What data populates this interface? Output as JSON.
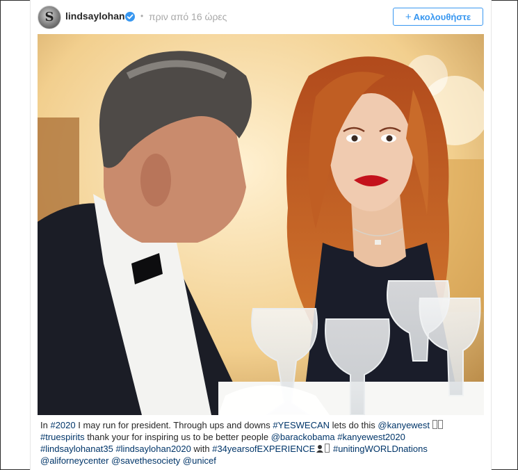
{
  "header": {
    "username": "lindsaylohan",
    "separator": "•",
    "timestamp": "πριν από 16 ώρες",
    "follow_label": "Ακολουθήστε",
    "follow_icon": "+"
  },
  "avatar": {
    "glyph": "S",
    "icon": "profile-avatar"
  },
  "icons": {
    "verified": "verified-badge-icon"
  },
  "colors": {
    "link": "#003569",
    "accent": "#3897f0",
    "muted": "#a8a8a8",
    "text": "#262626"
  },
  "caption": {
    "t0": "In ",
    "h_2020": "#2020",
    "t1": " I may run for president. Through ups and downs ",
    "h_yeswecan": "#YESWECAN",
    "t2": " lets do this ",
    "m_kanyewest": "@kanyewest",
    "h_truespirits": "#truespirits",
    "t3": " thank your for inspiring us to be better people ",
    "m_barackobama": "@barackobama",
    "h_kanyewest2020": "#kanyewest2020",
    "h_lindsaylohanat35": "#lindsaylohanat35",
    "h_lindsaylohan2020": "#lindsaylohan2020",
    "t4": " with ",
    "h_34years": "#34yearsofEXPERIENCE",
    "h_unitingworld": "#unitingWORLDnations",
    "m_aliforney": "@aliforneycenter",
    "m_savethesociety": "@savethesociety",
    "m_unicef": "@unicef"
  }
}
